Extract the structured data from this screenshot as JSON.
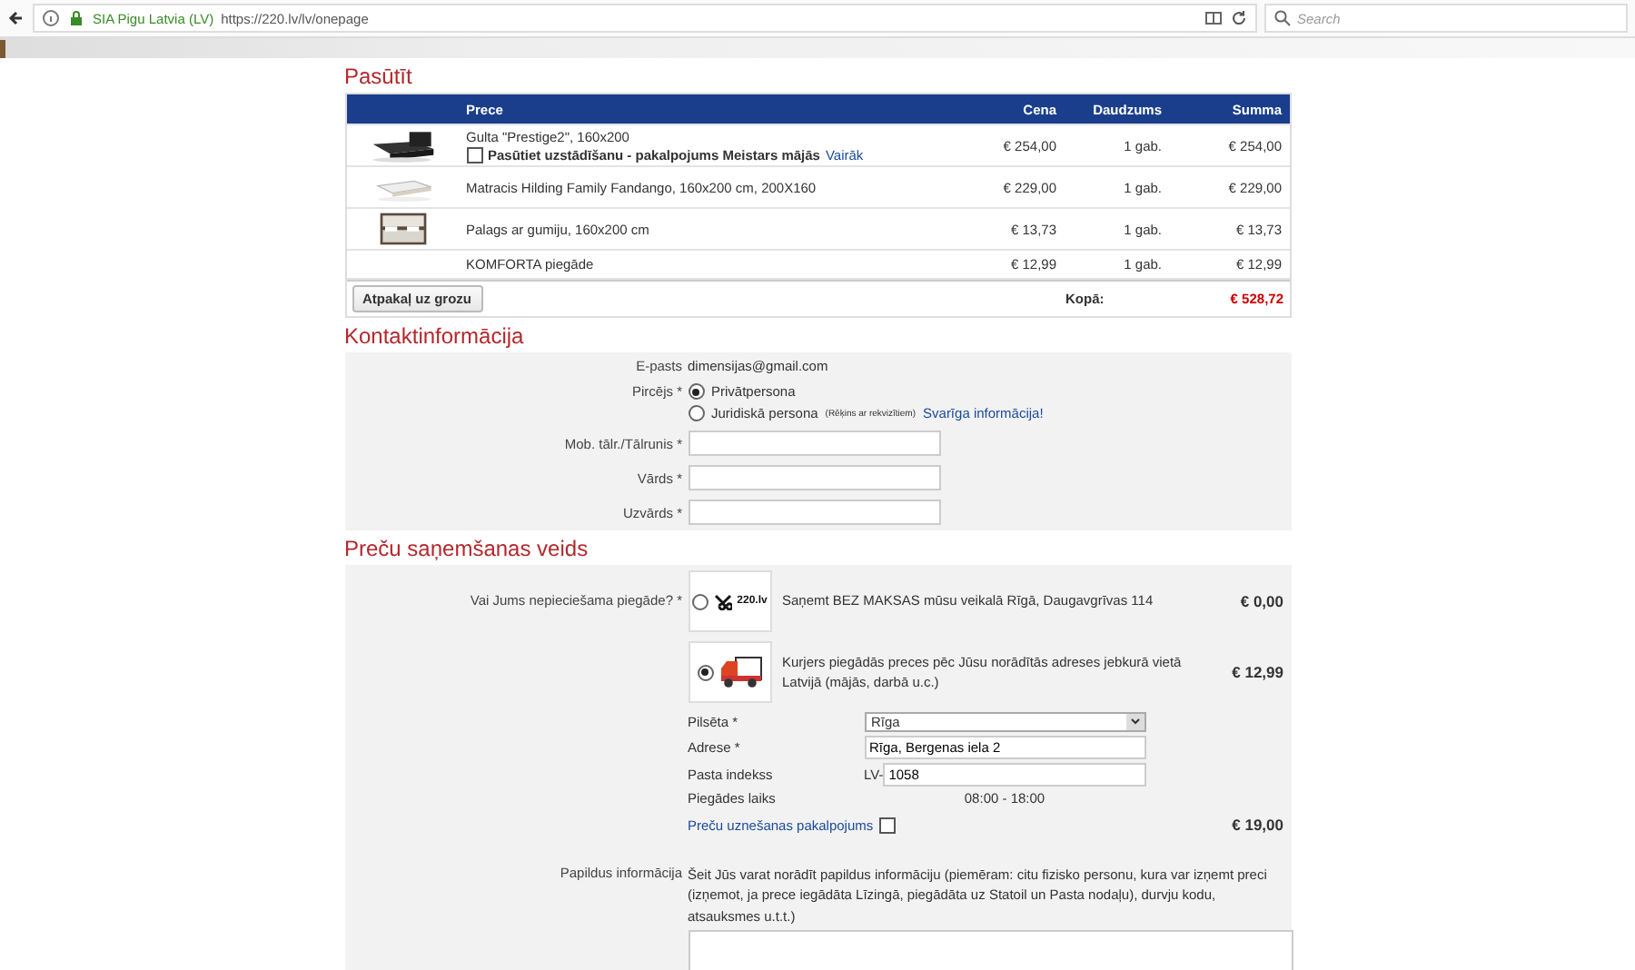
{
  "browser": {
    "site_identity": "SIA Pigu Latvia (LV)",
    "url": "https://220.lv/lv/onepage",
    "search_placeholder": "Search"
  },
  "order": {
    "title": "Pasūtīt",
    "columns": [
      "Prece",
      "Cena",
      "Daudzums",
      "Summa"
    ],
    "rows": [
      {
        "name": "Gulta \"Prestige2\", 160x200",
        "option": {
          "checked": false,
          "label": "Pasūtiet uzstādīšanu - pakalpojums Meistars mājās",
          "link": "Vairāk"
        },
        "price": "€ 254,00",
        "qty": "1 gab.",
        "sum": "€ 254,00"
      },
      {
        "name": "Matracis Hilding Family Fandango, 160x200 cm, 200X160",
        "price": "€ 229,00",
        "qty": "1 gab.",
        "sum": "€ 229,00"
      },
      {
        "name": "Palags ar gumiju, 160x200 cm",
        "price": "€ 13,73",
        "qty": "1 gab.",
        "sum": "€ 13,73"
      },
      {
        "name": "KOMFORTA piegāde",
        "price": "€ 12,99",
        "qty": "1 gab.",
        "sum": "€ 12,99"
      }
    ],
    "back_button": "Atpakaļ uz grozu",
    "total_label": "Kopā:",
    "total": "€ 528,72"
  },
  "contact": {
    "title": "Kontaktinformācija",
    "email_label": "E-pasts",
    "email": "dimensijas@gmail.com",
    "buyer_label": "Pircējs *",
    "buyer_options": [
      {
        "label": "Privātpersona",
        "selected": true
      },
      {
        "label": "Juridiskā persona",
        "note": "(Rēķins ar rekvizītiem)",
        "link": "Svarīga informācija!",
        "selected": false
      }
    ],
    "fields": [
      {
        "label": "Mob. tālr./Tālrunis *"
      },
      {
        "label": "Vārds *"
      },
      {
        "label": "Uzvārds *"
      }
    ]
  },
  "delivery": {
    "title": "Preču saņemšanas veids",
    "question": "Vai Jums nepieciešama piegāde? *",
    "options": [
      {
        "kind": "store",
        "logo_text": "220.lv",
        "selected": false,
        "text": "Saņemt BEZ MAKSAS mūsu veikalā Rīgā, Daugavgrīvas 114",
        "price": "€ 0,00"
      },
      {
        "kind": "courier",
        "selected": true,
        "text": "Kurjers piegādās preces pēc Jūsu norādītās adreses jebkurā vietā Latvijā (mājās, darbā u.c.)",
        "price": "€ 12,99"
      }
    ],
    "city_label": "Pilsēta *",
    "city": "Rīga",
    "address_label": "Adrese *",
    "address": "Rīga, Bergenas iela 2",
    "postal_label": "Pasta indekss",
    "postal_prefix": "LV-",
    "postal": "1058",
    "time_label": "Piegādes laiks",
    "time": "08:00 - 18:00",
    "carry_service": {
      "label": "Preču uznešanas pakalpojums",
      "checked": false,
      "price": "€ 19,00"
    },
    "extra_label": "Papildus informācija",
    "extra_hint": "Šeit Jūs varat norādīt papildus informāciju (piemēram: citu fizisko personu, kura var izņemt preci (izņemot, ja prece iegādāta Līzingā, piegādāta uz Statoil un Pasta nodaļu), durvju kodu, atsauksmes u.t.t.)"
  }
}
